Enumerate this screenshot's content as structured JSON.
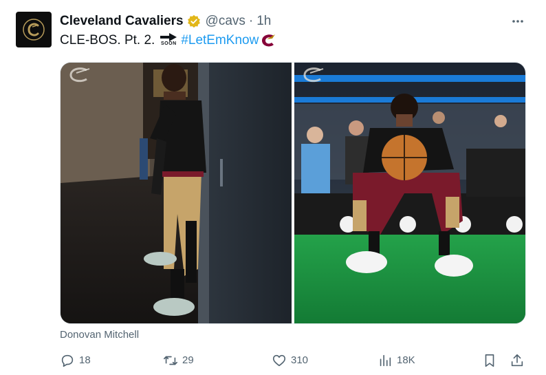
{
  "tweet": {
    "author_name": "Cleveland Cavaliers",
    "handle": "@cavs",
    "separator": "·",
    "time": "1h",
    "text_prefix": "CLE-BOS. Pt. 2.",
    "soon_label": "SOON",
    "hashtag": "#LetEmKnow",
    "media_caption": "Donovan Mitchell"
  },
  "icons": {
    "avatar": "cavs-c-logo-icon",
    "verified": "verified-gold-badge-icon",
    "more": "more-horizontal-icon",
    "soon": "soon-arrow-emoji-icon",
    "hashtag_logo": "cavs-hashtag-logo-icon"
  },
  "actions": {
    "replies": "18",
    "reposts": "29",
    "likes": "310",
    "views": "18K"
  },
  "colors": {
    "link": "#1d9bf0",
    "muted": "#536471",
    "text": "#0f1419",
    "verified_gold": "#e2b719",
    "cavs_wine": "#860038",
    "cavs_gold": "#b8860b"
  }
}
